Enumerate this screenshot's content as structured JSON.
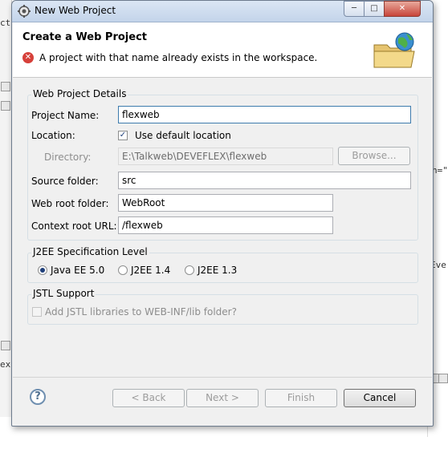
{
  "window": {
    "title": "New Web Project"
  },
  "header": {
    "title": "Create a Web Project",
    "error_message": "A project with that name already exists in the workspace."
  },
  "details": {
    "group_label": "Web Project Details",
    "project_name_label": "Project Name:",
    "project_name_value": "flexweb",
    "location_label": "Location:",
    "use_default_label": "Use default location",
    "use_default_checked": true,
    "directory_label": "Directory:",
    "directory_value": "E:\\Talkweb\\DEVEFLEX\\flexweb",
    "browse_label": "Browse...",
    "source_folder_label": "Source folder:",
    "source_folder_value": "src",
    "web_root_label": "Web root folder:",
    "web_root_value": "WebRoot",
    "context_root_label": "Context root URL:",
    "context_root_value": "/flexweb"
  },
  "j2ee": {
    "group_label": "J2EE Specification Level",
    "options": [
      "Java EE 5.0",
      "J2EE 1.4",
      "J2EE 1.3"
    ],
    "selected": "Java EE 5.0"
  },
  "jstl": {
    "group_label": "JSTL Support",
    "checkbox_label": "Add JSTL libraries to WEB-INF/lib folder?",
    "checked": false
  },
  "buttons": {
    "back_label": "< Back",
    "next_label": "Next >",
    "finish_label": "Finish",
    "cancel_label": "Cancel"
  },
  "background": {
    "frag_ct": "ct",
    "frag_h": "h=\"",
    "frag_eve": "Eve",
    "frag_ex": "ex"
  }
}
